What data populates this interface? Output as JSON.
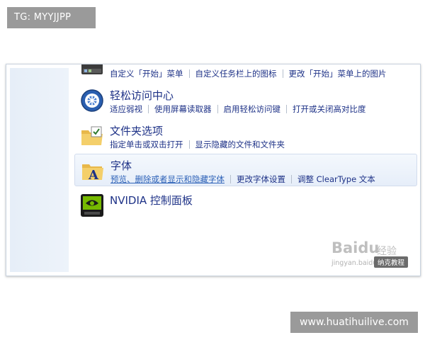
{
  "watermarks": {
    "top_left": "TG: MYYJJPP",
    "bottom_right": "www.huatihuilive.com"
  },
  "control_panel": {
    "items": [
      {
        "title": "",
        "icon": "taskbar-icon",
        "links": [
          "自定义「开始」菜单",
          "自定义任务栏上的图标",
          "更改「开始」菜单上的图片"
        ]
      },
      {
        "title": "轻松访问中心",
        "icon": "ease-of-access-icon",
        "links": [
          "适应弱视",
          "使用屏幕读取器",
          "启用轻松访问键",
          "打开或关闭高对比度"
        ]
      },
      {
        "title": "文件夹选项",
        "icon": "folder-options-icon",
        "links": [
          "指定单击或双击打开",
          "显示隐藏的文件和文件夹"
        ]
      },
      {
        "title": "字体",
        "icon": "fonts-folder-icon",
        "links": [
          "预览、删除或者显示和隐藏字体",
          "更改字体设置",
          "调整 ClearType 文本"
        ]
      },
      {
        "title": "NVIDIA 控制面板",
        "icon": "nvidia-icon",
        "links": []
      }
    ]
  },
  "baidu_watermark": {
    "logo": "Baidu",
    "suffix": "经验",
    "url": "jingyan.baidu.com",
    "badge": "纳克教程"
  },
  "colors": {
    "link": "#1e3287",
    "nav_pane": "#e6eef8",
    "hover": "#e6eef9"
  }
}
